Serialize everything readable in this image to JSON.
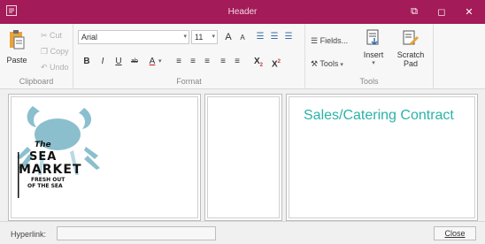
{
  "window": {
    "title": "Header",
    "restore_glyph": "⧉",
    "maximize_glyph": "◻",
    "close_glyph": "✕"
  },
  "ribbon": {
    "clipboard": {
      "label": "Clipboard",
      "paste": "Paste",
      "cut": "Cut",
      "copy": "Copy",
      "undo": "Undo"
    },
    "format": {
      "label": "Format",
      "font_name": "Arial",
      "font_size": "11",
      "grow_font": "A",
      "shrink_font": "A",
      "bullets_glyph": "☰",
      "numbering_glyph": "☰",
      "indent_glyph": "☰",
      "bold": "B",
      "italic": "I",
      "underline": "U",
      "strike": "ab",
      "font_color": "A",
      "align_left": "≡",
      "align_center": "≡",
      "align_right": "≡",
      "justify": "≡",
      "distribute": "≡",
      "subscript": "X",
      "subscript_mark": "2",
      "superscript": "X",
      "superscript_mark": "2"
    },
    "tools": {
      "label": "Tools",
      "fields": "Fields...",
      "tools": "Tools",
      "insert": "Insert",
      "scratch_pad_line1": "Scratch",
      "scratch_pad_line2": "Pad"
    }
  },
  "content": {
    "logo": {
      "line1": "The",
      "line2": "SEA",
      "line3": "MARKET",
      "line4": "FRESH OUT",
      "line5": "OF THE SEA"
    },
    "heading": "Sales/Catering Contract"
  },
  "footer": {
    "hyperlink_label": "Hyperlink:",
    "hyperlink_value": "",
    "close": "Close"
  },
  "colors": {
    "titlebar": "#a31b58",
    "heading": "#2ab3a6",
    "crab": "#7fb9c9"
  }
}
